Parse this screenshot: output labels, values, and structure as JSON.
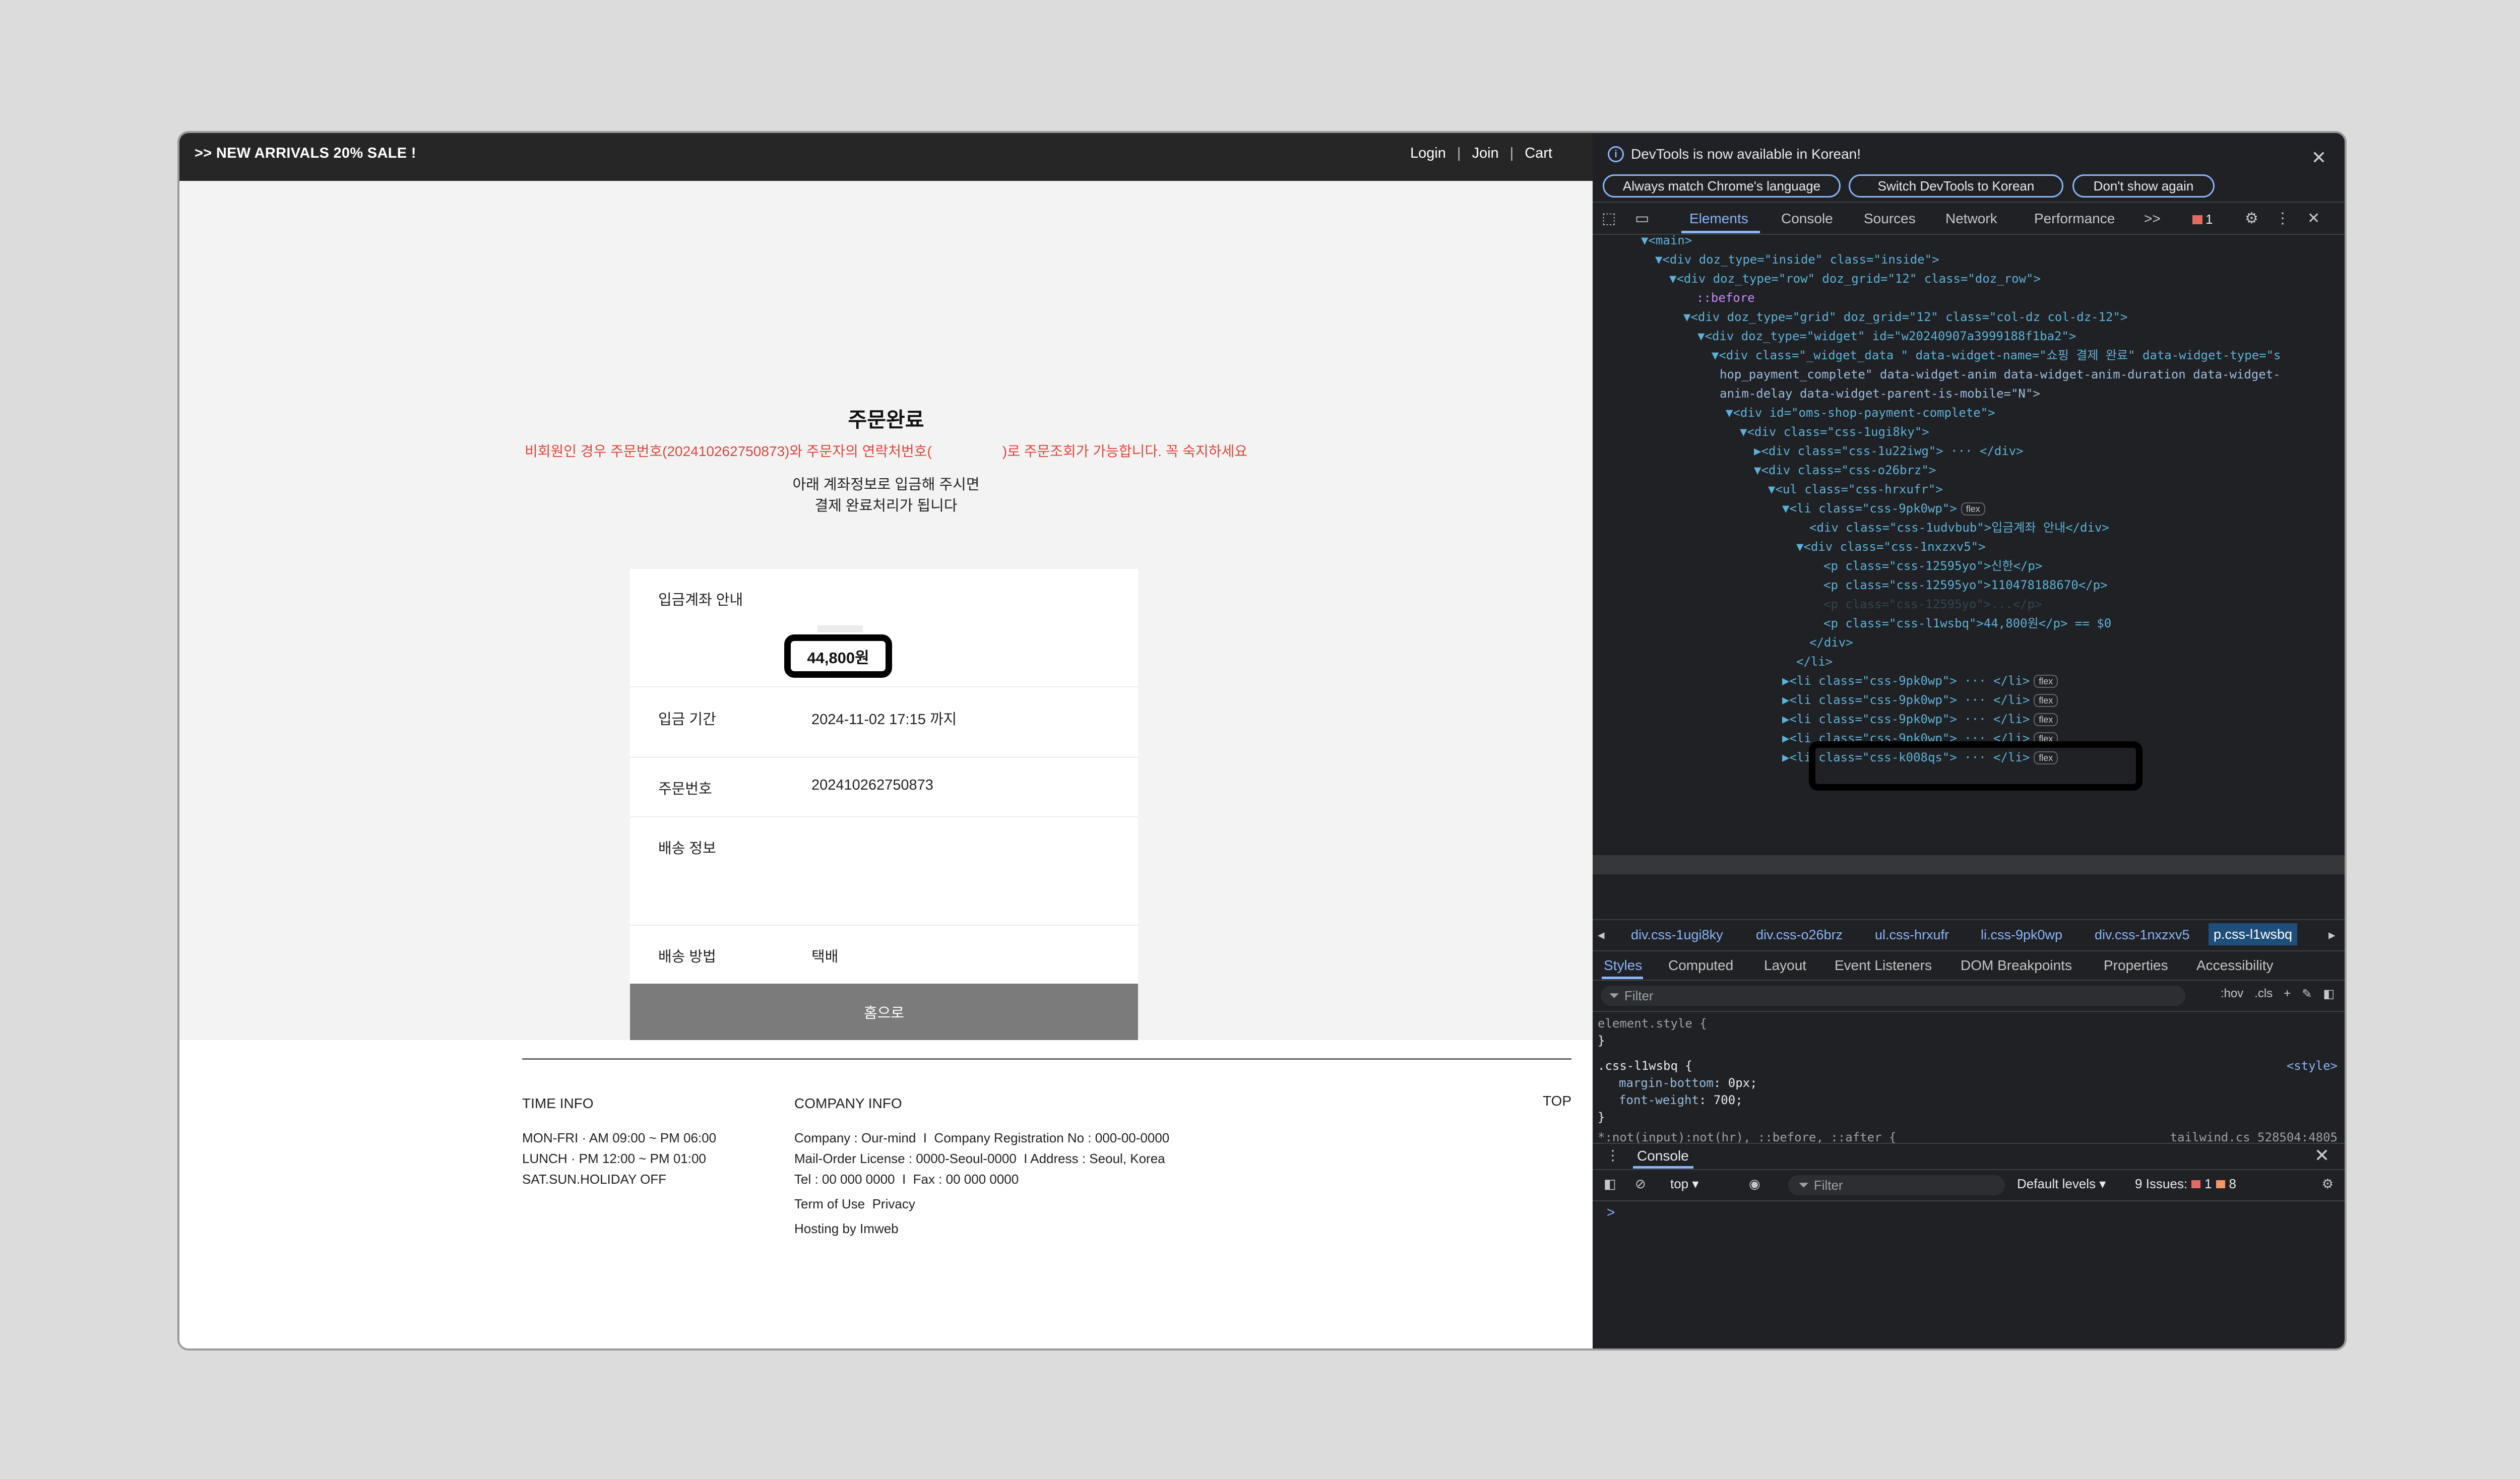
{
  "page": {
    "promo": ">> NEW ARRIVALS 20% SALE !",
    "nav": [
      "Login",
      "Join",
      "Cart"
    ],
    "nav_sep": "|",
    "title": "주문완료",
    "notice": "비회원인 경우 주문번호(202410262750873)와 주문자의 연락처번호(                  )로 주문조회가 가능합니다. 꼭 숙지하세요",
    "guide_line1": "아래 계좌정보로 입금해 주시면",
    "guide_line2": "결제 완료처리가 됩니다",
    "rows": {
      "account_label": "입금계좌 안내",
      "amount": "44,800원",
      "deadline_label": "입금 기간",
      "deadline_value": "2024-11-02 17:15 까지",
      "order_label": "주문번호",
      "order_value": "202410262750873",
      "shipping_label": "배송 정보",
      "method_label": "배송 방법",
      "method_value": "택배"
    },
    "home_button": "홈으로",
    "footer": {
      "time_head": "TIME INFO",
      "time_lines": [
        "MON-FRI · AM 09:00 ~ PM 06:00",
        "LUNCH · PM 12:00 ~ PM 01:00",
        "SAT.SUN.HOLIDAY OFF"
      ],
      "company_head": "COMPANY INFO",
      "company_lines": [
        "Company : Our-mind  I  Company Registration No : 000-00-0000",
        "Mail-Order License : 0000-Seoul-0000  I Address : Seoul, Korea",
        "Tel : 00 000 0000  I  Fax : 00 000 0000"
      ],
      "links": "Term of Use  Privacy",
      "hosting": "Hosting by Imweb",
      "top": "TOP"
    }
  },
  "devtools": {
    "info": "DevTools is now available in Korean!",
    "info_buttons": [
      "Always match Chrome's language",
      "Switch DevTools to Korean",
      "Don't show again"
    ],
    "tabs": [
      "Elements",
      "Console",
      "Sources",
      "Network",
      "Performance"
    ],
    "more": ">>",
    "error_count": "1",
    "dom_lines": [
      "▼<main>",
      "▼<div doz_type=\"inside\" class=\"inside\">",
      "▼<div doz_type=\"row\" doz_grid=\"12\" class=\"doz_row\">",
      "::before",
      "▼<div doz_type=\"grid\" doz_grid=\"12\" class=\"col-dz col-dz-12\">",
      "▼<div doz_type=\"widget\" id=\"w20240907a3999188f1ba2\">",
      "▼<div class=\"_widget_data \" data-widget-name=\"쇼핑 결제 완료\" data-widget-type=\"s",
      "hop_payment_complete\" data-widget-anim data-widget-anim-duration data-widget-",
      "anim-delay data-widget-parent-is-mobile=\"N\">",
      "▼<div id=\"oms-shop-payment-complete\">",
      "▼<div class=\"css-1ugi8ky\">",
      "▶<div class=\"css-1u22iwg\"> ··· </div>",
      "▼<div class=\"css-o26brz\">",
      "▼<ul class=\"css-hrxufr\">",
      "▼<li class=\"css-9pk0wp\">",
      "<div class=\"css-1udvbub\">입금계좌 안내</div>",
      "▼<div class=\"css-1nxzxv5\">",
      "<p class=\"css-12595yo\">신한</p>",
      "<p class=\"css-12595yo\">110478188670</p>",
      "<p class=\"css-12595yo\">...</p>",
      "<p class=\"css-l1wsbq\">44,800원</p> == $0",
      "</div>",
      "</li>",
      "▶<li class=\"css-9pk0wp\"> ··· </li>",
      "▶<li class=\"css-9pk0wp\"> ··· </li>",
      "▶<li class=\"css-9pk0wp\"> ··· </li>",
      "▶<li class=\"css-9pk0wp\"> ··· </li>",
      "▶<li class=\"css-k008qs\"> ··· </li>"
    ],
    "flex_badge": "flex",
    "crumbs": [
      "div.css-1ugi8ky",
      "div.css-o26brz",
      "ul.css-hrxufr",
      "li.css-9pk0wp",
      "div.css-1nxzxv5",
      "p.css-l1wsbq"
    ],
    "style_tabs": [
      "Styles",
      "Computed",
      "Layout",
      "Event Listeners",
      "DOM Breakpoints",
      "Properties",
      "Accessibility"
    ],
    "filter_placeholder": "Filter",
    "filter_tools": [
      ":hov",
      ".cls",
      "+"
    ],
    "styles": {
      "element_style": "element.style {",
      "close": "}",
      "selector": ".css-l1wsbq {",
      "source": "<style>",
      "prop1": "margin-bottom",
      "val1": "0px;",
      "prop2": "font-weight",
      "val2": "700;",
      "next_selector": "*:not(input):not(hr), ::before, ::after {",
      "next_source": "tailwind.cs 528504:4805"
    },
    "console": {
      "tab": "Console",
      "context": "top ▾",
      "filter": "Filter",
      "levels": "Default levels ▾",
      "issues": "9 Issues:",
      "issue_err": "1",
      "issue_warn": "8",
      "prompt": ">"
    }
  }
}
